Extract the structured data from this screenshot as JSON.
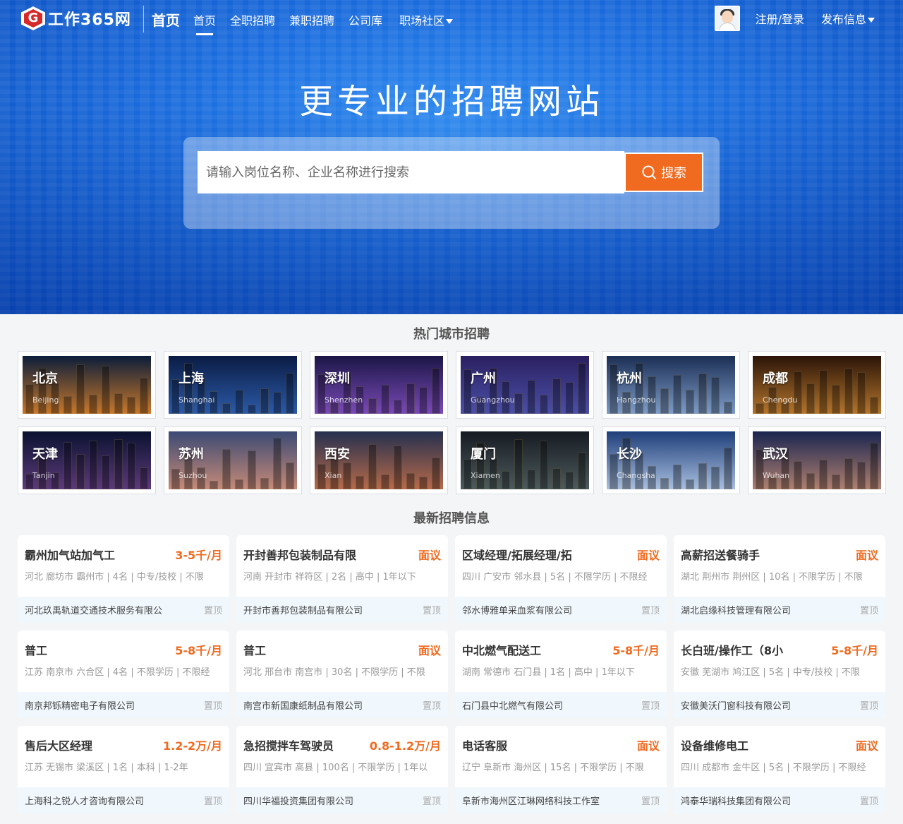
{
  "nav": {
    "logo_text": "工作365网",
    "home_big": "首页",
    "links": [
      {
        "label": "首页",
        "active": true
      },
      {
        "label": "全职招聘"
      },
      {
        "label": "兼职招聘"
      },
      {
        "label": "公司库"
      },
      {
        "label": "职场社区",
        "dropdown": true
      }
    ],
    "login": "注册/登录",
    "publish": "发布信息"
  },
  "hero": {
    "title": "更专业的招聘网站",
    "search_placeholder": "请输入岗位名称、企业名称进行搜索",
    "search_button": "搜索",
    "icon": "search-icon"
  },
  "sections": {
    "hot_cities": "热门城市招聘",
    "latest_jobs": "最新招聘信息"
  },
  "cities": [
    {
      "name": "北京",
      "en": "Beijing",
      "colors": [
        "#0b1d3a",
        "#c9782b"
      ]
    },
    {
      "name": "上海",
      "en": "Shanghai",
      "colors": [
        "#0a1c44",
        "#2c5aa8"
      ]
    },
    {
      "name": "深圳",
      "en": "Shenzhen",
      "colors": [
        "#1b1646",
        "#7a4ab8"
      ]
    },
    {
      "name": "广州",
      "en": "Guangzhou",
      "colors": [
        "#2a2060",
        "#4b4fa8"
      ]
    },
    {
      "name": "杭州",
      "en": "Hangzhou",
      "colors": [
        "#1c2f55",
        "#7d9cc8"
      ]
    },
    {
      "name": "成都",
      "en": "Chengdu",
      "colors": [
        "#2a1408",
        "#b5752c"
      ]
    },
    {
      "name": "天津",
      "en": "Tanjin",
      "colors": [
        "#0a1230",
        "#5c3a7a"
      ]
    },
    {
      "name": "苏州",
      "en": "Suzhou",
      "colors": [
        "#3b4a74",
        "#c78a78"
      ]
    },
    {
      "name": "西安",
      "en": "Xian",
      "colors": [
        "#25304f",
        "#b86a4a"
      ]
    },
    {
      "name": "厦门",
      "en": "Xiamen",
      "colors": [
        "#161a22",
        "#4d5b5c"
      ]
    },
    {
      "name": "长沙",
      "en": "Changsha",
      "colors": [
        "#1f3f7a",
        "#a8bfe0"
      ]
    },
    {
      "name": "武汉",
      "en": "Wuhan",
      "colors": [
        "#1a2550",
        "#b08070"
      ]
    }
  ],
  "jobs": [
    {
      "title": "霸州加气站加气工",
      "salary": "3-5千/月",
      "meta": "河北 廊坊市 霸州市 | 4名 | 中专/技校 | 不限",
      "company": "河北玖禹轨道交通技术服务有限公",
      "pin": "置顶"
    },
    {
      "title": "开封善邦包装制品有限",
      "salary": "面议",
      "meta": "河南 开封市 祥符区 | 2名 | 高中 | 1年以下",
      "company": "开封市善邦包装制品有限公司",
      "pin": "置顶"
    },
    {
      "title": "区域经理/拓展经理/拓",
      "salary": "面议",
      "meta": "四川 广安市 邻水县 | 5名 | 不限学历 | 不限经",
      "company": "邻水博雅单采血浆有限公司",
      "pin": "置顶"
    },
    {
      "title": "高薪招送餐骑手",
      "salary": "面议",
      "meta": "湖北 荆州市 荆州区 | 10名 | 不限学历 | 不限",
      "company": "湖北启缘科技管理有限公司",
      "pin": "置顶"
    },
    {
      "title": "普工",
      "salary": "5-8千/月",
      "meta": "江苏 南京市 六合区 | 4名 | 不限学历 | 不限经",
      "company": "南京邦铄精密电子有限公司",
      "pin": "置顶"
    },
    {
      "title": "普工",
      "salary": "面议",
      "meta": "河北 邢台市 南宫市 | 30名 | 不限学历 | 不限",
      "company": "南宫市新国康纸制品有限公司",
      "pin": "置顶"
    },
    {
      "title": "中北燃气配送工",
      "salary": "5-8千/月",
      "meta": "湖南 常德市 石门县 | 1名 | 高中 | 1年以下",
      "company": "石门县中北燃气有限公司",
      "pin": "置顶"
    },
    {
      "title": "长白班/操作工（8小",
      "salary": "5-8千/月",
      "meta": "安徽 芜湖市 鸠江区 | 5名 | 中专/技校 | 不限",
      "company": "安徽美沃门窗科技有限公司",
      "pin": "置顶"
    },
    {
      "title": "售后大区经理",
      "salary": "1.2-2万/月",
      "meta": "江苏 无锡市 梁溪区 | 1名 | 本科 | 1-2年",
      "company": "上海科之锐人才咨询有限公司",
      "pin": "置顶"
    },
    {
      "title": "急招搅拌车驾驶员",
      "salary": "0.8-1.2万/月",
      "meta": "四川 宜宾市 高县 | 100名 | 不限学历 | 1年以",
      "company": "四川华福投资集团有限公司",
      "pin": "置顶"
    },
    {
      "title": "电话客服",
      "salary": "面议",
      "meta": "辽宁 阜新市 海州区 | 15名 | 不限学历 | 不限",
      "company": "阜新市海州区江琳网络科技工作室",
      "pin": "置顶"
    },
    {
      "title": "设备维修电工",
      "salary": "面议",
      "meta": "四川 成都市 金牛区 | 5名 | 不限学历 | 不限经",
      "company": "鸿泰华瑞科技集团有限公司",
      "pin": "置顶"
    }
  ]
}
